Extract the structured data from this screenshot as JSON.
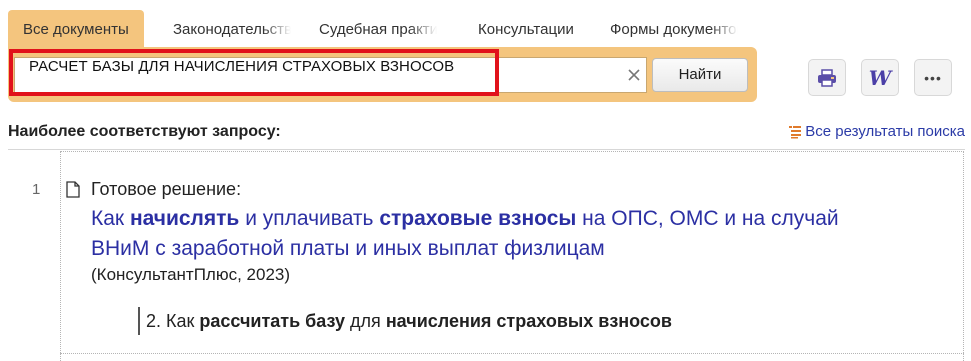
{
  "tabs": [
    {
      "label": "Все документы",
      "active": true
    },
    {
      "label": "Законодательство",
      "active": false
    },
    {
      "label": "Судебная практика",
      "active": false
    },
    {
      "label": "Консультации",
      "active": false
    },
    {
      "label": "Формы документов",
      "active": false
    }
  ],
  "search": {
    "value": "РАСЧЕТ БАЗЫ ДЛЯ НАЧИСЛЕНИЯ СТРАХОВЫХ ВЗНОСОВ",
    "button_label": "Найти"
  },
  "toolbar": {
    "print_icon": "printer-icon",
    "word_label": "W",
    "more_label": "•••"
  },
  "results": {
    "header": "Наиболее соответствуют запросу:",
    "all_results_link": "Все результаты поиска",
    "items": [
      {
        "number": "1",
        "kind": "Готовое решение:",
        "title_parts": [
          {
            "text": "Как ",
            "bold": false
          },
          {
            "text": "начислять",
            "bold": true
          },
          {
            "text": " и уплачивать ",
            "bold": false
          },
          {
            "text": "страховые взносы",
            "bold": true
          },
          {
            "text": " на ОПС, ОМС и на случай ВНиМ с заработной платы и иных выплат физлицам",
            "bold": false
          }
        ],
        "source": "(КонсультантПлюс, 2023)",
        "snippet_parts": [
          {
            "text": "2. Как ",
            "bold": false
          },
          {
            "text": "рассчитать базу",
            "bold": true
          },
          {
            "text": " для ",
            "bold": false
          },
          {
            "text": "начисления страховых взносов",
            "bold": true
          }
        ]
      }
    ]
  },
  "colors": {
    "accent": "#f4c57e",
    "highlight_border": "#e1121b",
    "link": "#2b2fa3",
    "word_icon": "#4b3fa7",
    "printer_icon": "#5b4ea8",
    "link_icon": "#e07a2b"
  }
}
